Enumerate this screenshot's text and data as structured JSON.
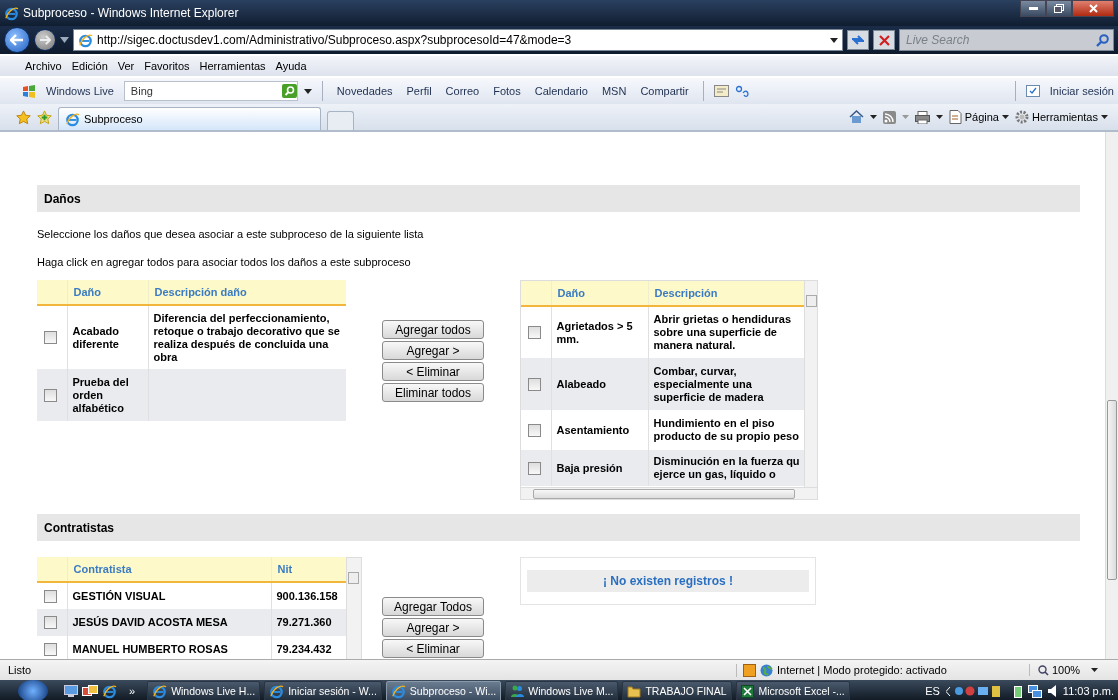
{
  "window": {
    "title": "Subproceso - Windows Internet Explorer"
  },
  "address_bar": {
    "url": "http://sigec.doctusdev1.com/Administrativo/Subproceso.aspx?subprocesoId=47&mode=3",
    "search_placeholder": "Live Search"
  },
  "menu": [
    "Archivo",
    "Edición",
    "Ver",
    "Favoritos",
    "Herramientas",
    "Ayuda"
  ],
  "links_toolbar": {
    "brand": "Windows Live",
    "search_value": "Bing",
    "links": [
      "Novedades",
      "Perfil",
      "Correo",
      "Fotos",
      "Calendario",
      "MSN",
      "Compartir"
    ],
    "sign_in": "Iniciar sesión"
  },
  "tabs": [
    {
      "label": "Subproceso",
      "selected": true
    }
  ],
  "command_bar": [
    "Página",
    "Herramientas"
  ],
  "danos": {
    "title": "Daños",
    "instructions": [
      "Seleccione los daños que desea asociar a este subproceso de la siguiente lista",
      "Haga click en agregar todos para asociar todos los daños a este subproceso"
    ],
    "available": {
      "columns": [
        "Daño",
        "Descripción daño"
      ],
      "rows": [
        {
          "name": "Acabado diferente",
          "description": "Diferencia del perfeccionamiento, retoque o trabajo decorativo que se realiza después de concluida una obra",
          "checked": false
        },
        {
          "name": "Prueba del orden alfabético",
          "description": "",
          "checked": false
        }
      ]
    },
    "buttons": [
      "Agregar todos",
      "Agregar >",
      "< Eliminar",
      "Eliminar todos"
    ],
    "associated": {
      "columns": [
        "Daño",
        "Descripción"
      ],
      "rows": [
        {
          "name": "Agrietados > 5 mm.",
          "description": "Abrir grietas o hendiduras\nsobre una superficie de\nmanera natural.",
          "checked": false
        },
        {
          "name": "Alabeado",
          "description": "Combar, curvar,\nespecialmente una\nsuperficie de madera",
          "checked": false
        },
        {
          "name": "Asentamiento",
          "description": "Hundimiento en el piso\nproducto de su propio peso",
          "checked": false
        },
        {
          "name": "Baja presión",
          "description": "Disminución en la fuerza qu\nejerce un gas, líquido o",
          "checked": false
        }
      ]
    }
  },
  "contratistas": {
    "title": "Contratistas",
    "available": {
      "columns": [
        "Contratista",
        "Nit"
      ],
      "rows": [
        {
          "name": "GESTIÓN VISUAL",
          "nit": "900.136.158",
          "checked": false
        },
        {
          "name": "JESÚS DAVID ACOSTA MESA",
          "nit": "79.271.360",
          "checked": false
        },
        {
          "name": "MANUEL HUMBERTO ROSAS",
          "nit": "79.234.432",
          "checked": false
        }
      ]
    },
    "buttons": [
      "Agregar Todos",
      "Agregar >",
      "< Eliminar"
    ],
    "empty_message": "¡ No existen registros !"
  },
  "status_bar": {
    "text": "Listo",
    "zone": "Internet | Modo protegido: activado",
    "zoom": "100%"
  },
  "taskbar": {
    "overflow": "»",
    "items": [
      {
        "label": "Windows Live H...",
        "kind": "ie",
        "selected": false
      },
      {
        "label": "Iniciar sesión - W...",
        "kind": "ie",
        "selected": false
      },
      {
        "label": "Subproceso - Wi...",
        "kind": "ie",
        "selected": true
      },
      {
        "label": "Windows Live M...",
        "kind": "messenger",
        "selected": false
      },
      {
        "label": "TRABAJO FINAL",
        "kind": "folder",
        "selected": false
      },
      {
        "label": "Microsoft Excel -...",
        "kind": "excel",
        "selected": false
      }
    ],
    "language": "ES",
    "clock": "11:03 p.m."
  }
}
